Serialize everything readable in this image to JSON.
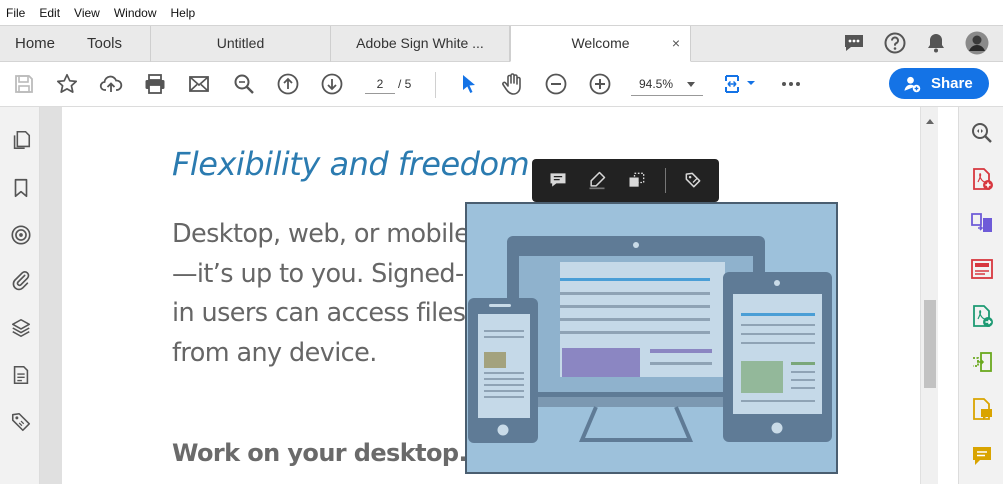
{
  "menu": [
    "File",
    "Edit",
    "View",
    "Window",
    "Help"
  ],
  "nav": {
    "home": "Home",
    "tools": "Tools"
  },
  "tabs": [
    {
      "label": "Untitled",
      "active": false
    },
    {
      "label": "Adobe Sign White ...",
      "active": false
    },
    {
      "label": "Welcome",
      "active": true,
      "close": "×"
    }
  ],
  "toolbar": {
    "page_current": "2",
    "page_total": "/ 5",
    "zoom": "94.5%",
    "share_label": "Share"
  },
  "document": {
    "heading": "Flexibility and freedom",
    "body": "Desktop, web, or mobile—it’s up to you. Signed-in users can access files from any device.",
    "subheading": "Work on your desktop."
  },
  "colors": {
    "accent": "#1473e6",
    "heading": "#2b7bb0",
    "illustration_bg": "#9dc1db",
    "device_frame": "#5f7b96"
  },
  "icons": {
    "left_panel": [
      "pages-icon",
      "bookmark-icon",
      "target-icon",
      "attachment-icon",
      "layers-icon",
      "document-icon",
      "tag-icon"
    ],
    "right_panel": [
      "zoom-search-icon",
      "create-pdf-icon",
      "combine-icon",
      "organize-icon",
      "export-pdf-icon",
      "edit-pdf-icon",
      "comment-icon",
      "sticky-note-icon"
    ]
  }
}
